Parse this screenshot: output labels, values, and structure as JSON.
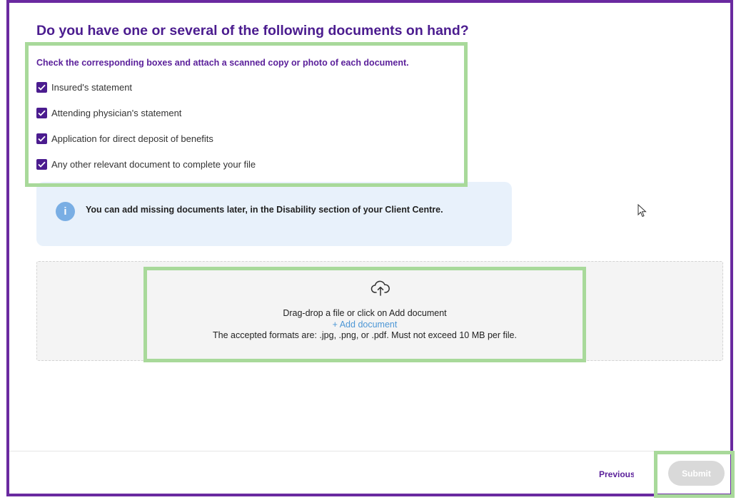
{
  "page": {
    "title": "Do you have one or several of the following documents on hand?",
    "instructions": "Check the corresponding boxes and attach a scanned copy or photo of each document."
  },
  "documents": [
    {
      "label": "Insured's statement",
      "checked": true
    },
    {
      "label": "Attending physician's statement",
      "checked": true
    },
    {
      "label": "Application for direct deposit of benefits",
      "checked": true
    },
    {
      "label": "Any other relevant document to complete your file",
      "checked": true
    }
  ],
  "info": {
    "icon": "info-icon",
    "text": "You can add missing documents later, in the Disability section of your Client Centre."
  },
  "upload": {
    "icon": "cloud-upload-icon",
    "drop_text": "Drag-drop a file or click on Add document",
    "add_label": "+ Add document",
    "formats_text": "The accepted formats are: .jpg, .png, or .pdf. Must not exceed 10 MB per file."
  },
  "footer": {
    "previous_label": "Previous",
    "submit_label": "Submit"
  },
  "colors": {
    "brand_purple": "#4b1c8f",
    "highlight_green": "#a8d99a",
    "info_blue": "#79aee4",
    "link_blue": "#4d97d6"
  }
}
